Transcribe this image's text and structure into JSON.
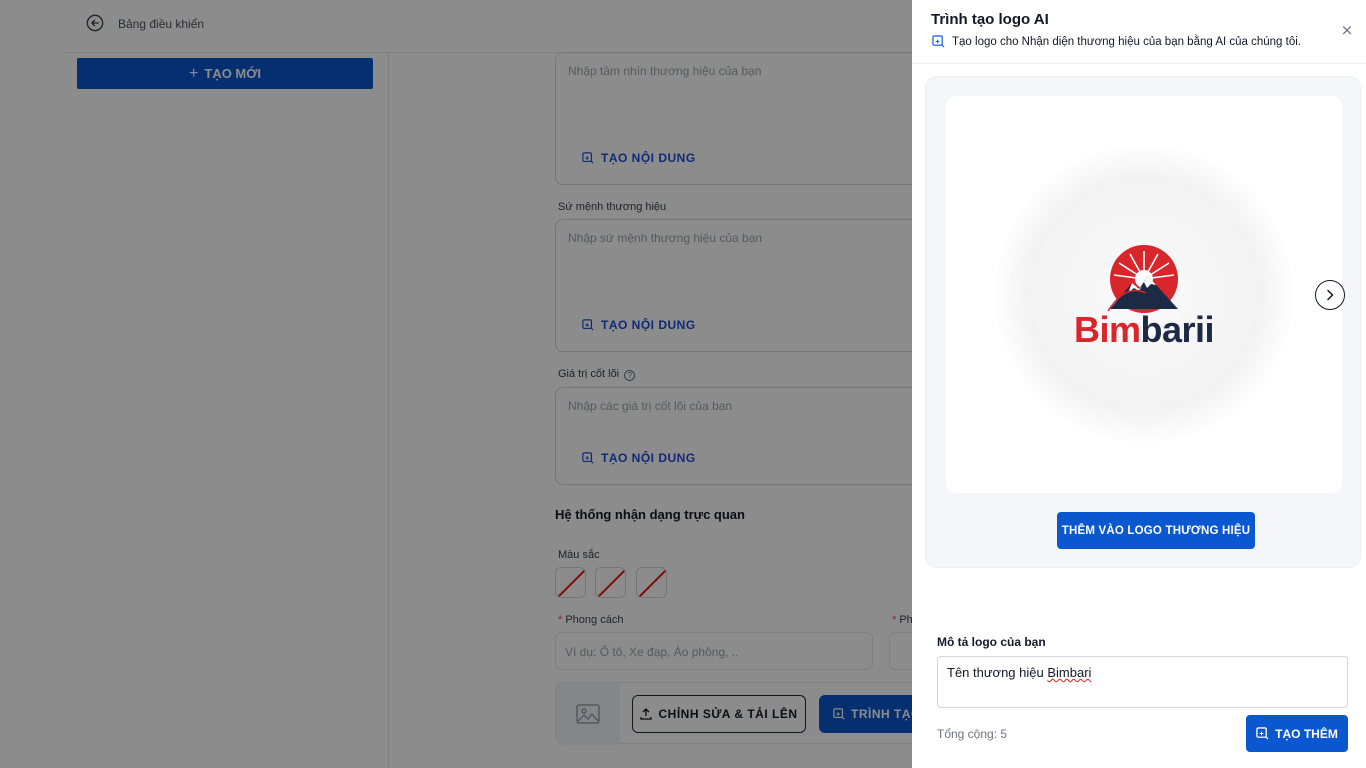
{
  "app": {
    "breadcrumb": "Bảng điều khiển",
    "new_button": "TẠO MỚI",
    "fields": {
      "vision_placeholder": "Nhập tầm nhìn thương hiệu của bạn",
      "mission_label": "Sứ mệnh thương hiệu",
      "mission_placeholder": "Nhập sứ mệnh thương hiệu của bạn",
      "values_label": "Giá trị cốt lõi",
      "values_placeholder": "Nhập các giá trị cốt lõi của bạn",
      "generate_content": "TẠO NỘI DUNG"
    },
    "visual_identity": {
      "title": "Hệ thống nhận dạng trực quan",
      "colors_label": "Màu sắc",
      "style_label": "Phong cách",
      "style_placeholder": "Ví dụ: Ô tô, Xe đạp, Áo phông, ..",
      "style2_label": "Ph",
      "edit_upload": "CHỈNH SỬA & TẢI LÊN",
      "logo_maker": "TRÌNH TẠO"
    }
  },
  "drawer": {
    "title": "Trình tạo logo AI",
    "subtitle": "Tạo logo cho Nhận diện thương hiệu của bạn bằng AI của chúng tôi.",
    "close": "×",
    "logo_preview": {
      "brand_red": "Bim",
      "brand_dark": "barii"
    },
    "add_logo_button": "THÊM VÀO LOGO THƯƠNG HIỆU",
    "describe_label": "Mô tả logo của bạn",
    "describe_value_prefix": "Tên thương hiệu ",
    "describe_value_word": "Bimbari",
    "total_label": "Tổng cộng: 5",
    "generate_more_button": "TẠO THÊM"
  },
  "colors": {
    "accent": "#0b57d0",
    "overlay": "rgba(0,0,0,0.45)",
    "logo_red": "#d8262c",
    "logo_navy": "#1d2a44"
  },
  "icons": [
    "back-arrow-icon",
    "plus-icon",
    "ai-generate-icon",
    "help-icon",
    "upload-icon",
    "image-placeholder-icon",
    "close-icon",
    "chevron-right-icon"
  ]
}
